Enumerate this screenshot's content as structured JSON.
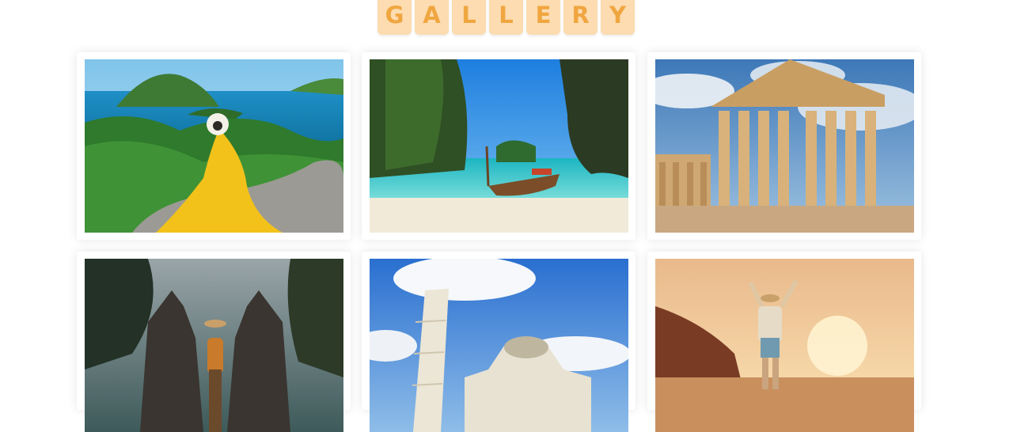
{
  "title_letters": [
    "G",
    "A",
    "L",
    "L",
    "E",
    "R",
    "Y"
  ],
  "gallery": [
    {
      "name": "island-viewpoint-woman-yellow-dress"
    },
    {
      "name": "longtail-boat-tropical-beach"
    },
    {
      "name": "parthenon-acropolis"
    },
    {
      "name": "bali-temple-gate-traveler"
    },
    {
      "name": "leaning-tower-of-pisa"
    },
    {
      "name": "hiker-sunset-beach"
    }
  ]
}
